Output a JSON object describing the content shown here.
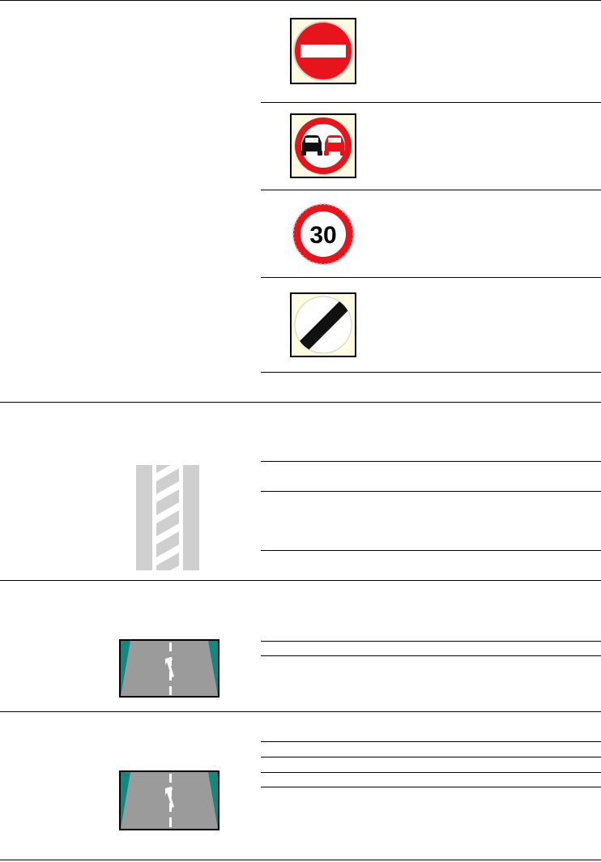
{
  "signs": [
    {
      "name": "no-entry-sign"
    },
    {
      "name": "no-overtaking-sign"
    },
    {
      "name": "speed-limit-sign",
      "value": "30"
    },
    {
      "name": "national-speed-limit-sign"
    }
  ],
  "markings": [
    {
      "name": "hatched-central-marking"
    },
    {
      "name": "lane-arrow-broken-line-marking"
    },
    {
      "name": "lane-arrow-broken-line-marking-2"
    }
  ],
  "colors": {
    "sign_red": "#e8141c",
    "sign_frame_bg": "#fdfce0",
    "road_grey": "#9b9b9b",
    "verge_teal": "#0e8a84",
    "hatch_grey": "#cfcfcf"
  }
}
